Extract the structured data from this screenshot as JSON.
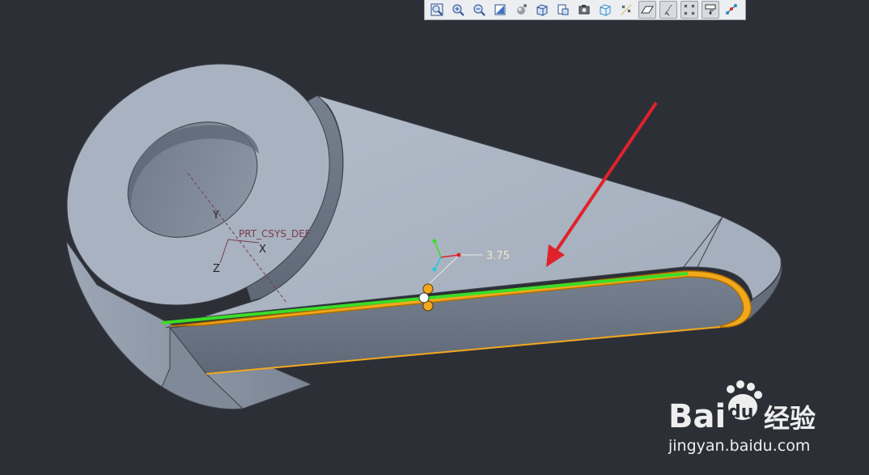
{
  "toolbar": {
    "buttons": [
      {
        "icon": "zoom-refit-icon",
        "pressed": false
      },
      {
        "icon": "zoom-in-icon",
        "pressed": false
      },
      {
        "icon": "zoom-out-icon",
        "pressed": false
      },
      {
        "icon": "repaint-icon",
        "pressed": false
      },
      {
        "icon": "display-style-icon",
        "pressed": false
      },
      {
        "icon": "saved-orientations-icon",
        "pressed": false
      },
      {
        "icon": "view-manager-icon",
        "pressed": false
      },
      {
        "icon": "perspective-view-icon",
        "pressed": false
      },
      {
        "icon": "section-view-icon",
        "pressed": false
      },
      {
        "icon": "datum-points-display-icon",
        "pressed": false
      },
      {
        "icon": "datum-planes-display-icon",
        "pressed": true
      },
      {
        "icon": "datum-axes-display-icon",
        "pressed": true
      },
      {
        "icon": "point-tags-display-icon",
        "pressed": true
      },
      {
        "icon": "csys-display-icon",
        "pressed": true
      },
      {
        "icon": "annotation-display-icon",
        "pressed": false
      }
    ]
  },
  "model": {
    "csys_label": "PRT_CSYS_DEF",
    "axis_x": "X",
    "axis_y": "Y",
    "axis_z": "Z",
    "round_dimension": "3.75",
    "colors": {
      "body_light": "#a9b3c1",
      "body_mid": "#8f9aa9",
      "body_dark": "#6d7787",
      "highlight": "#f2a81d",
      "edge": "#3cdc28",
      "arrow": "#e0222a"
    }
  },
  "watermark": {
    "brand_left": "Bai",
    "brand_right": "du",
    "brand_cn": "经验",
    "url": "jingyan.baidu.com"
  }
}
